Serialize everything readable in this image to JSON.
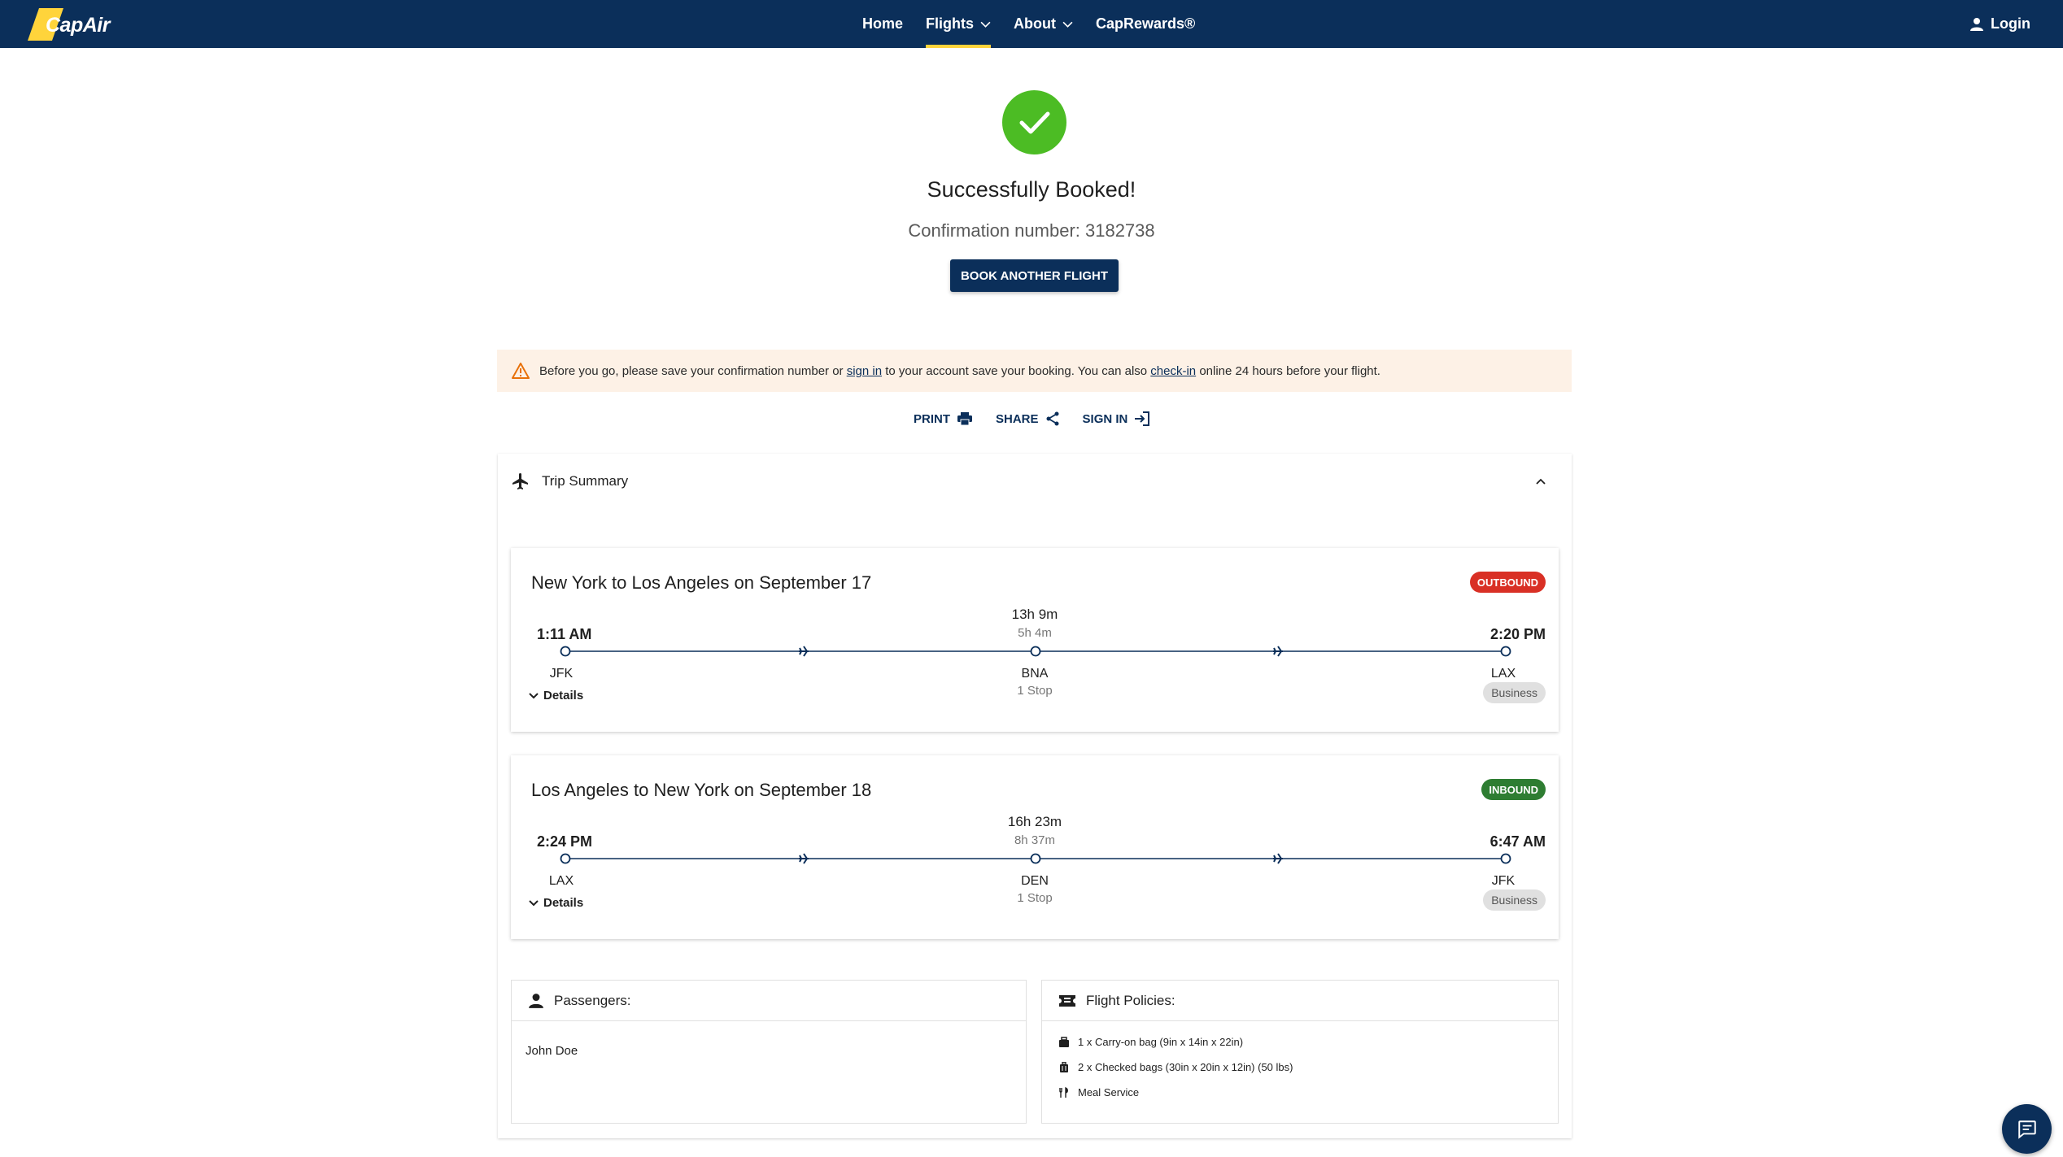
{
  "brand": {
    "name": "CapAir"
  },
  "nav": {
    "items": [
      {
        "label": "Home",
        "active": false,
        "dropdown": false
      },
      {
        "label": "Flights",
        "active": true,
        "dropdown": true
      },
      {
        "label": "About",
        "active": false,
        "dropdown": true
      },
      {
        "label": "CapRewards®",
        "active": false,
        "dropdown": false
      }
    ],
    "login": "Login"
  },
  "success": {
    "title": "Successfully Booked!",
    "confirmation": "Confirmation number: 3182738",
    "button": "BOOK ANOTHER FLIGHT"
  },
  "warning": {
    "part1": "Before you go, please save your confirmation number or ",
    "link1": "sign in",
    "part2": " to your account save your booking. You can also ",
    "link2": "check-in",
    "part3": " online 24 hours before your flight."
  },
  "actions": {
    "print": "PRINT",
    "share": "SHARE",
    "signin": "SIGN IN"
  },
  "trip_summary": {
    "title": "Trip Summary",
    "flights": [
      {
        "title": "New York to Los Angeles on September 17",
        "badge": "OUTBOUND",
        "depart_time": "1:11 AM",
        "arrive_time": "2:20 PM",
        "total_duration": "13h 9m",
        "layover": "5h 4m",
        "origin": "JFK",
        "stop": "BNA",
        "destination": "LAX",
        "stops": "1 Stop",
        "details": "Details",
        "class": "Business"
      },
      {
        "title": "Los Angeles to New York on September 18",
        "badge": "INBOUND",
        "depart_time": "2:24 PM",
        "arrive_time": "6:47 AM",
        "total_duration": "16h 23m",
        "layover": "8h 37m",
        "origin": "LAX",
        "stop": "DEN",
        "destination": "JFK",
        "stops": "1 Stop",
        "details": "Details",
        "class": "Business"
      }
    ]
  },
  "passengers": {
    "title": "Passengers:",
    "names": [
      "John Doe"
    ]
  },
  "policies": {
    "title": "Flight Policies:",
    "items": [
      "1 x Carry-on bag (9in x 14in x 22in)",
      "2 x Checked bags (30in x 20in x 12in) (50 lbs)",
      "Meal Service"
    ]
  },
  "colors": {
    "navy": "#0b2f5a",
    "accent": "#ffd43b",
    "success": "#4cbc24",
    "outbound": "#d93025",
    "inbound": "#2e7d32"
  }
}
